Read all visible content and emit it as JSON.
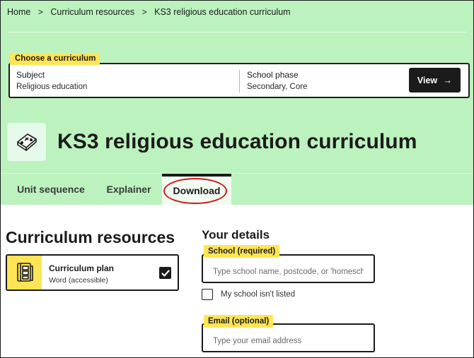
{
  "breadcrumb": {
    "items": [
      "Home",
      "Curriculum resources",
      "KS3 religious education curriculum"
    ],
    "separator": ">"
  },
  "picker": {
    "tag": "Choose a curriculum",
    "subject_label": "Subject",
    "subject_value": "Religious education",
    "phase_label": "School phase",
    "phase_value": "Secondary, Core",
    "view_label": "View",
    "view_arrow": "→"
  },
  "header": {
    "title": "KS3 religious education curriculum",
    "icon": "religious-education-book-icon"
  },
  "tabs": [
    "Unit sequence",
    "Explainer",
    "Download"
  ],
  "active_tab": "Download",
  "resources": {
    "title": "Curriculum resources",
    "items": [
      {
        "name": "Curriculum plan",
        "format": "Word (accessible)",
        "checked": true,
        "icon": "curriculum-plan-icon"
      }
    ]
  },
  "details": {
    "title": "Your details",
    "school_label": "School (required)",
    "school_placeholder": "Type school name, postcode, or 'homeschool'",
    "not_listed_label": "My school isn't listed",
    "email_label": "Email (optional)",
    "email_placeholder": "Type your email address"
  },
  "colors": {
    "header_bg": "#bcf2be",
    "tag_yellow": "#ffe555",
    "annotation_red": "#d0191b",
    "dark": "#1b1b1b"
  }
}
